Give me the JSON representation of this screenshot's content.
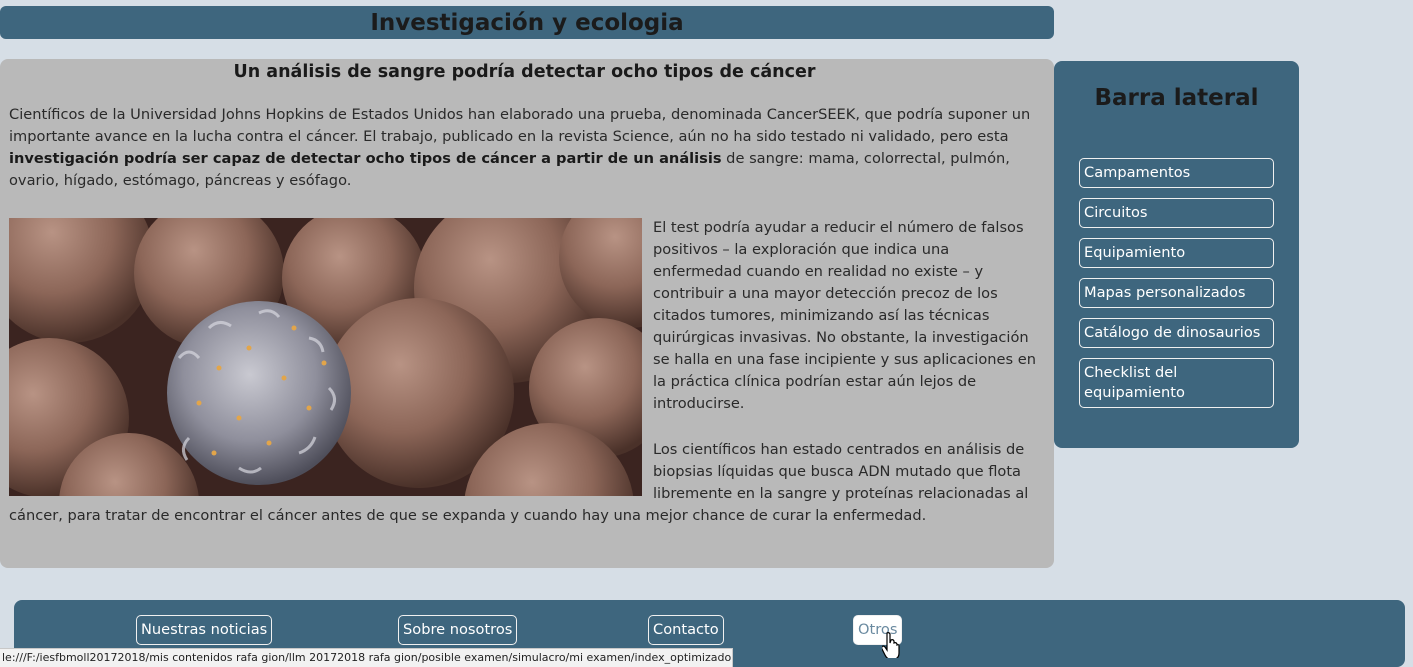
{
  "header": {
    "title": "Investigación y ecologia"
  },
  "article": {
    "title": "Un análisis de sangre podría detectar ocho tipos de cáncer",
    "intro_start": "Científicos de la Universidad Johns Hopkins de Estados Unidos han elaborado una prueba, denominada CancerSEEK, que podría suponer un importante avance en la lucha contra el cáncer. El trabajo, publicado en la revista Science, aún no ha sido testado ni validado, pero esta ",
    "intro_bold": "investigación podría ser capaz de detectar ocho tipos de cáncer a partir de un análisis",
    "intro_end": " de sangre: mama, colorrectal, pulmón, ovario, hígado, estómago, páncreas y esófago.",
    "paragraph2": "El test podría ayudar a reducir el número de falsos positivos – la exploración que indica una enfermedad cuando en realidad no existe – y contribuir a una mayor detección precoz de los citados tumores, minimizando así las técnicas quirúrgicas invasivas. No obstante, la investigación se halla en una fase incipiente y sus aplicaciones en la práctica clínica podrían estar aún lejos de introducirse.",
    "paragraph3": "Los científicos han estado centrados en análisis de biopsias líquidas que busca ADN mutado que flota libremente en la sangre y proteínas relacionadas al cáncer, para tratar de encontrar el cáncer antes de que se expanda y cuando hay una mejor chance de curar la enfermedad."
  },
  "sidebar": {
    "title": "Barra lateral",
    "items": [
      {
        "label": "Campamentos"
      },
      {
        "label": "Circuitos"
      },
      {
        "label": "Equipamiento"
      },
      {
        "label": "Mapas personalizados"
      },
      {
        "label": "Catálogo de dinosaurios"
      },
      {
        "label": "Checklist del equipamiento"
      }
    ]
  },
  "footer": {
    "items": [
      {
        "label": "Nuestras noticias"
      },
      {
        "label": "Sobre nosotros"
      },
      {
        "label": "Contacto"
      },
      {
        "label": "Otros"
      }
    ]
  },
  "status_bar": {
    "url": "le:///F:/iesfbmoll20172018/mis contenidos rafa gion/llm 20172018 rafa gion/posible examen/simulacro/mi examen/index_optimizado.html"
  },
  "colors": {
    "panel": "#3e667e",
    "article_bg": "#b9b9b9",
    "page_bg": "#d6dee6"
  }
}
